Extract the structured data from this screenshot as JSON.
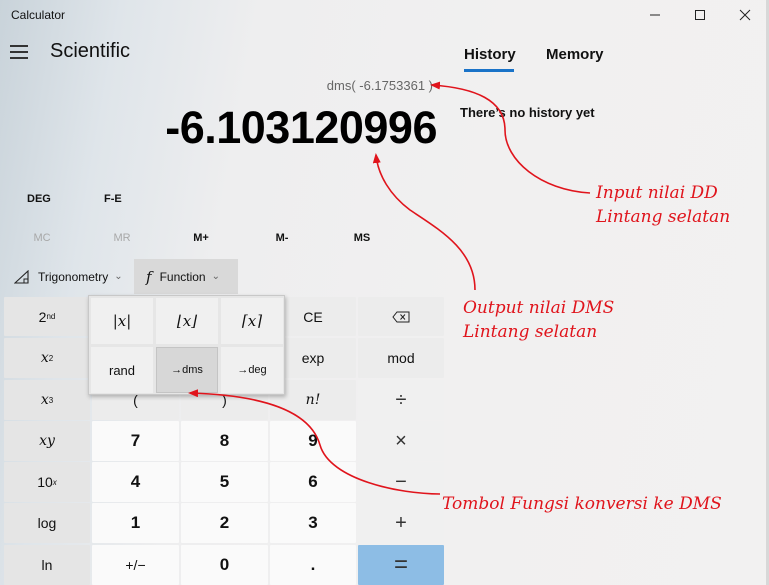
{
  "window": {
    "title": "Calculator",
    "controls": {
      "minimize": "—",
      "maximize": "☐",
      "close": "✕"
    }
  },
  "header": {
    "menu_icon": "hamburger-icon",
    "mode": "Scientific"
  },
  "side_panel": {
    "tabs": [
      {
        "label": "History",
        "active": true
      },
      {
        "label": "Memory",
        "active": false
      }
    ],
    "empty_message": "There’s no history yet",
    "accent_color": "#1a73c8"
  },
  "display": {
    "expression": "dms( -6.1753361 )",
    "result": "-6.103120996"
  },
  "mode_buttons": {
    "angle": "DEG",
    "fe": "F-E"
  },
  "memory_buttons": [
    {
      "label": "MC",
      "enabled": false
    },
    {
      "label": "MR",
      "enabled": false
    },
    {
      "label": "M+",
      "enabled": true
    },
    {
      "label": "M-",
      "enabled": true
    },
    {
      "label": "MS",
      "enabled": true
    }
  ],
  "dropdowns": {
    "trigonometry": {
      "label": "Trigonometry",
      "icon": "triangle-ruler-icon"
    },
    "function": {
      "label": "Function",
      "icon": "integral-f-icon",
      "open": true
    }
  },
  "keypad": {
    "col1": [
      "2nd",
      "x²",
      "x³",
      "xʸ",
      "10ˣ",
      "log",
      "ln"
    ],
    "row1_rest": [
      "CE",
      "⌫"
    ],
    "row2_rest": [
      "exp",
      "mod"
    ],
    "row3": [
      "(",
      ")",
      "n!",
      "÷"
    ],
    "row4": [
      "7",
      "8",
      "9",
      "×"
    ],
    "row5": [
      "4",
      "5",
      "6",
      "−"
    ],
    "row6": [
      "1",
      "2",
      "3",
      "+"
    ],
    "row7": [
      "+/−",
      "0",
      ".",
      "="
    ],
    "equals_color": "#8dbde5"
  },
  "function_popup": {
    "items": [
      "|x|",
      "⌊x⌋",
      "⌈x⌉",
      "rand",
      "→dms",
      "→deg"
    ],
    "selected": "→dms"
  },
  "annotations": {
    "input": [
      "Input nilai DD",
      "Lintang selatan"
    ],
    "output": [
      "Output nilai DMS",
      "Lintang selatan"
    ],
    "button": "Tombol Fungsi konversi ke DMS",
    "color": "#e0141c"
  }
}
